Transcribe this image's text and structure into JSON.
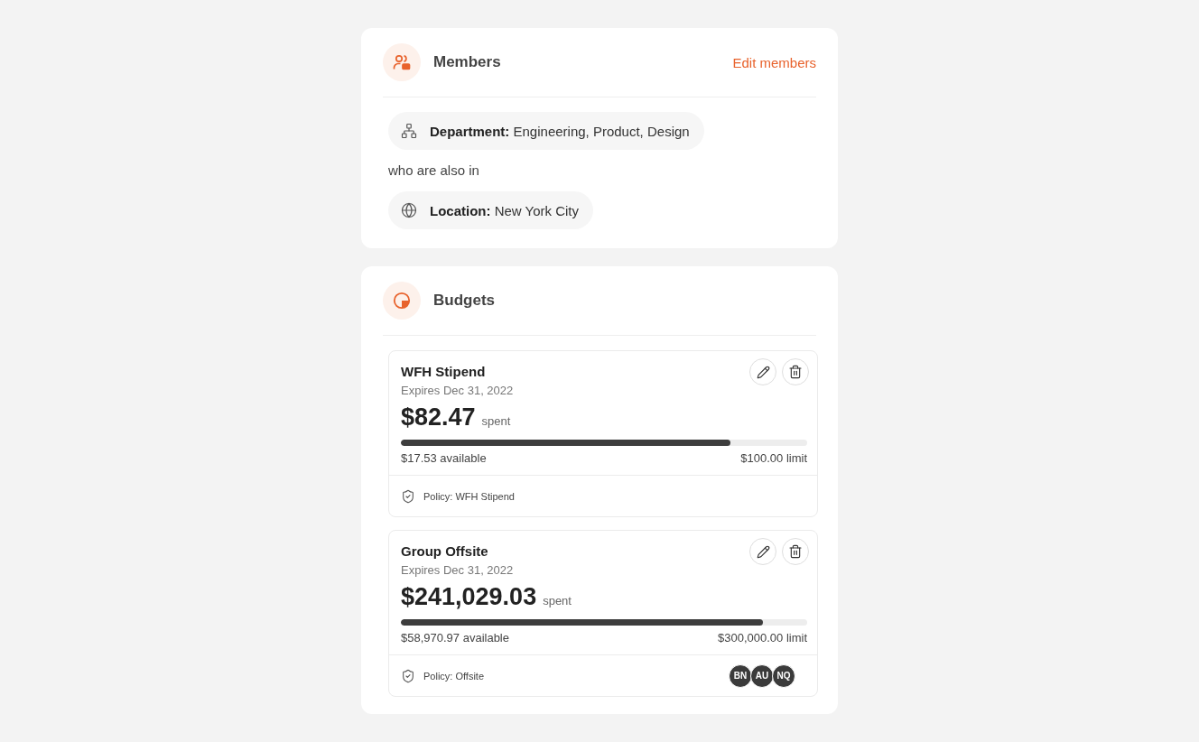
{
  "members": {
    "title": "Members",
    "edit_link": "Edit members",
    "rules": [
      {
        "kind": "department",
        "text": "**Department:** Engineering, Product, Design"
      },
      {
        "kind": "connector",
        "text": "who are also in"
      },
      {
        "kind": "location",
        "text": "**Location:** New York City"
      }
    ]
  },
  "budgets": {
    "title": "Budgets",
    "items": [
      {
        "name": "WFH Stipend",
        "expires": "Expires Dec 31, 2022",
        "amount": "$82.47",
        "amount_suffix": "spent",
        "level": 0.81,
        "available": "$17.53 available",
        "limit": "$100.00 limit",
        "policy": "Policy: WFH Stipend"
      },
      {
        "name": "Group Offsite",
        "expires": "Expires Dec 31, 2022",
        "amount": "$241,029.03",
        "amount_suffix": "spent",
        "level": 0.89,
        "available": "$58,970.97 available",
        "limit": "$300,000.00 limit",
        "policy": "Policy: Offsite",
        "assignees": [
          "BN",
          "AU",
          "NQ"
        ]
      }
    ]
  }
}
